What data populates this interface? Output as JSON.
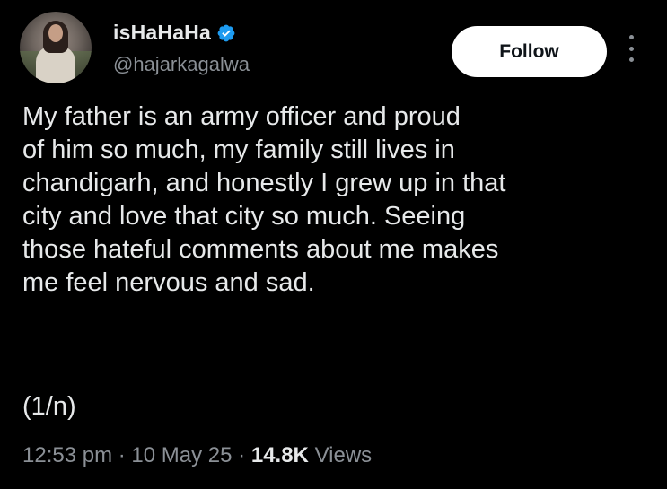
{
  "author": {
    "display_name": "isHaHaHa",
    "handle": "@hajarkagalwa",
    "verified": true,
    "verified_color": "#1d9bf0"
  },
  "actions": {
    "follow_label": "Follow",
    "more_icon": "more-vertical-icon"
  },
  "tweet": {
    "lines": [
      "My father is an army officer and proud",
      "of him so much, my family still lives in",
      "chandigarh, and honestly I grew up in that",
      "city and love that city so much. Seeing",
      "those hateful comments about me makes",
      "me feel nervous and sad."
    ],
    "thread_marker": "(1/n)"
  },
  "meta": {
    "time": "12:53 pm",
    "separator": "·",
    "date": "10 May 25",
    "views_count": "14.8K",
    "views_label": "Views"
  },
  "colors": {
    "background": "#000000",
    "text": "#e7e9ea",
    "secondary": "#8b9096",
    "button_bg": "#ffffff"
  }
}
